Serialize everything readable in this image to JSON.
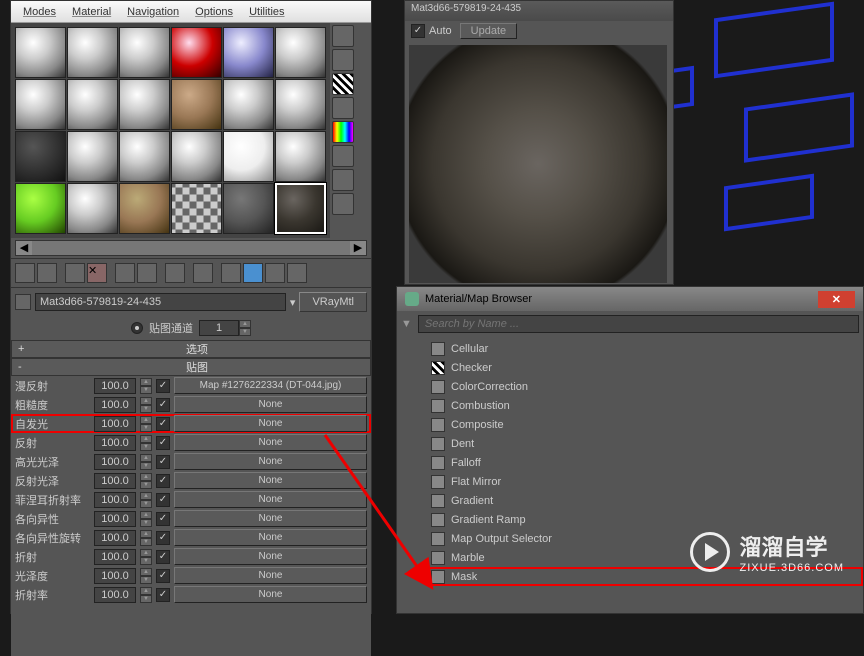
{
  "menubar": [
    "Modes",
    "Material",
    "Navigation",
    "Options",
    "Utilities"
  ],
  "material_name": "Mat3d66-579819-24-435",
  "material_type": "VRayMtl",
  "map_channel_label": "贴图通道",
  "map_channel_value": "1",
  "rollouts": {
    "options": {
      "sign": "+",
      "title": "选项"
    },
    "maps": {
      "sign": "-",
      "title": "贴图"
    }
  },
  "map_rows": [
    {
      "label": "漫反射",
      "amount": "100.0",
      "on": true,
      "map": "Map #1276222334 (DT-044.jpg)",
      "hl": false
    },
    {
      "label": "粗糙度",
      "amount": "100.0",
      "on": true,
      "map": "None",
      "hl": false
    },
    {
      "label": "自发光",
      "amount": "100.0",
      "on": true,
      "map": "None",
      "hl": true
    },
    {
      "label": "反射",
      "amount": "100.0",
      "on": true,
      "map": "None",
      "hl": false
    },
    {
      "label": "高光光泽",
      "amount": "100.0",
      "on": true,
      "map": "None",
      "hl": false
    },
    {
      "label": "反射光泽",
      "amount": "100.0",
      "on": true,
      "map": "None",
      "hl": false
    },
    {
      "label": "菲涅耳折射率",
      "amount": "100.0",
      "on": true,
      "map": "None",
      "hl": false
    },
    {
      "label": "各向异性",
      "amount": "100.0",
      "on": true,
      "map": "None",
      "hl": false
    },
    {
      "label": "各向异性旋转",
      "amount": "100.0",
      "on": true,
      "map": "None",
      "hl": false
    },
    {
      "label": "折射",
      "amount": "100.0",
      "on": true,
      "map": "None",
      "hl": false
    },
    {
      "label": "光泽度",
      "amount": "100.0",
      "on": true,
      "map": "None",
      "hl": false
    },
    {
      "label": "折射率",
      "amount": "100.0",
      "on": true,
      "map": "None",
      "hl": false
    }
  ],
  "preview": {
    "title": "Mat3d66-579819-24-435",
    "auto_label": "Auto",
    "update_label": "Update"
  },
  "browser": {
    "title": "Material/Map Browser",
    "search_placeholder": "Search by Name ...",
    "items": [
      {
        "name": "Cellular",
        "hl": false,
        "icon": "cell"
      },
      {
        "name": "Checker",
        "hl": false,
        "icon": "checker"
      },
      {
        "name": "ColorCorrection",
        "hl": false,
        "icon": ""
      },
      {
        "name": "Combustion",
        "hl": false,
        "icon": ""
      },
      {
        "name": "Composite",
        "hl": false,
        "icon": ""
      },
      {
        "name": "Dent",
        "hl": false,
        "icon": "dent"
      },
      {
        "name": "Falloff",
        "hl": false,
        "icon": ""
      },
      {
        "name": "Flat Mirror",
        "hl": false,
        "icon": ""
      },
      {
        "name": "Gradient",
        "hl": false,
        "icon": ""
      },
      {
        "name": "Gradient Ramp",
        "hl": false,
        "icon": ""
      },
      {
        "name": "Map Output Selector",
        "hl": false,
        "icon": ""
      },
      {
        "name": "Marble",
        "hl": false,
        "icon": "marble"
      },
      {
        "name": "Mask",
        "hl": true,
        "icon": ""
      }
    ]
  },
  "watermark": {
    "main": "溜溜自学",
    "sub": "ZIXUE.3D66.COM"
  }
}
